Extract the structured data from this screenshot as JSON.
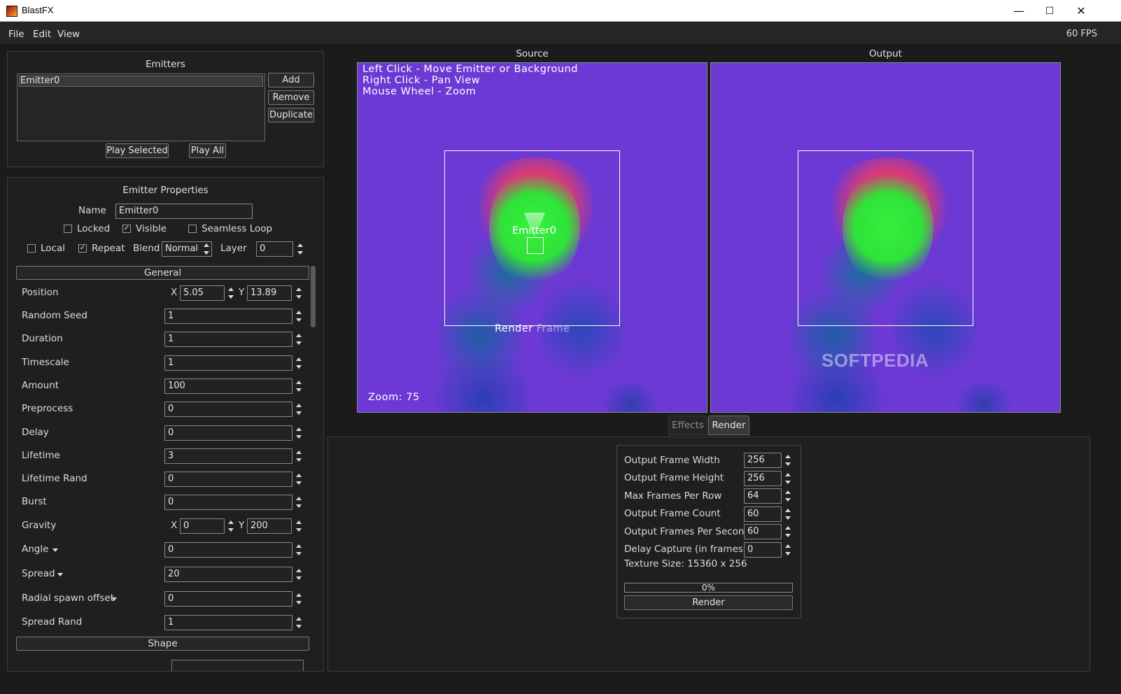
{
  "window": {
    "title": "BlastFX",
    "minimize": "—",
    "maximize": "☐",
    "close": "✕"
  },
  "menubar": {
    "items": [
      "File",
      "Edit",
      "View"
    ],
    "fps": "60 FPS"
  },
  "emitters": {
    "title": "Emitters",
    "list": [
      "Emitter0"
    ],
    "add": "Add",
    "remove": "Remove",
    "duplicate": "Duplicate",
    "play_selected": "Play Selected",
    "play_all": "Play All"
  },
  "props": {
    "title": "Emitter Properties",
    "name_label": "Name",
    "name_value": "Emitter0",
    "locked": "Locked",
    "visible": "Visible",
    "seamless": "Seamless Loop",
    "local": "Local",
    "repeat": "Repeat",
    "blend_label": "Blend",
    "blend_value": "Normal",
    "layer_label": "Layer",
    "layer_value": "0",
    "general": "General",
    "shape": "Shape",
    "position": {
      "label": "Position",
      "x_label": "X",
      "x": "5.05",
      "y_label": "Y",
      "y": "13.89"
    },
    "random_seed": {
      "label": "Random Seed",
      "value": "1"
    },
    "duration": {
      "label": "Duration",
      "value": "1"
    },
    "timescale": {
      "label": "Timescale",
      "value": "1"
    },
    "amount": {
      "label": "Amount",
      "value": "100"
    },
    "preprocess": {
      "label": "Preprocess",
      "value": "0"
    },
    "delay": {
      "label": "Delay",
      "value": "0"
    },
    "lifetime": {
      "label": "Lifetime",
      "value": "3"
    },
    "lifetime_rand": {
      "label": "Lifetime Rand",
      "value": "0"
    },
    "burst": {
      "label": "Burst",
      "value": "0"
    },
    "gravity": {
      "label": "Gravity",
      "x_label": "X",
      "x": "0",
      "y_label": "Y",
      "y": "200"
    },
    "angle": {
      "label": "Angle",
      "value": "0"
    },
    "spread": {
      "label": "Spread",
      "value": "20"
    },
    "radial": {
      "label": "Radial spawn offset",
      "value": "0"
    },
    "spread_rand": {
      "label": "Spread Rand",
      "value": "1"
    }
  },
  "source": {
    "title": "Source",
    "hint1": "Left Click - Move Emitter or Background",
    "hint2": "Right Click - Pan View",
    "hint3": "Mouse Wheel - Zoom",
    "emitter_label": "Emitter0",
    "render_frame_a": "Render",
    "render_frame_b": "Frame",
    "zoom": "Zoom: 75"
  },
  "output": {
    "title": "Output",
    "watermark": "SOFTPEDIA"
  },
  "tabs": {
    "effects": "Effects",
    "render": "Render"
  },
  "render": {
    "width_label": "Output Frame Width",
    "width": "256",
    "height_label": "Output Frame Height",
    "height": "256",
    "max_label": "Max Frames Per Row",
    "max": "64",
    "count_label": "Output Frame Count",
    "count": "60",
    "fps_label": "Output Frames Per Second",
    "fps": "60",
    "delay_label": "Delay Capture (in frames)",
    "delay": "0",
    "texture": "Texture Size: 15360 x 256",
    "progress": "0%",
    "render_button": "Render"
  },
  "colors": {
    "viewport_bg": "#6c39d4",
    "accent_green": "#2ee63a",
    "accent_red": "#e8305a"
  }
}
